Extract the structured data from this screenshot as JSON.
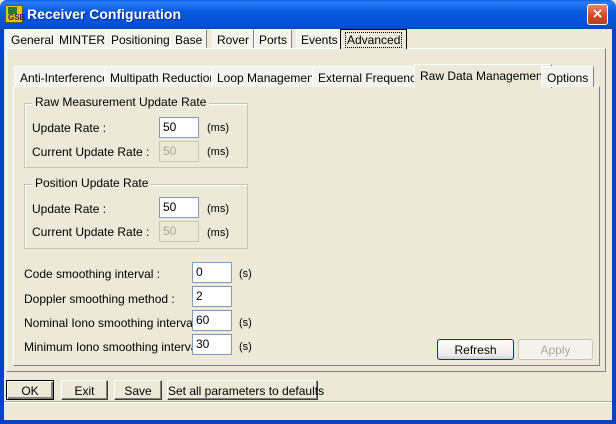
{
  "window": {
    "title": "Receiver Configuration",
    "close_glyph": "×",
    "icon_text": "GSB"
  },
  "outer_tabs": [
    "General",
    "MINTER",
    "Positioning",
    "Base",
    "Rover",
    "Ports",
    "Events",
    "Advanced"
  ],
  "inner_tabs": [
    "Anti-Interference",
    "Multipath Reduction",
    "Loop Management",
    "External Frequency",
    "Raw Data Management",
    "Options"
  ],
  "raw_group": {
    "title": "Raw Measurement Update Rate",
    "update_label": "Update Rate :",
    "update_value": "50",
    "update_unit": "(ms)",
    "current_label": "Current Update Rate :",
    "current_value": "50",
    "current_unit": "(ms)"
  },
  "pos_group": {
    "title": "Position Update Rate",
    "update_label": "Update Rate :",
    "update_value": "50",
    "update_unit": "(ms)",
    "current_label": "Current Update Rate :",
    "current_value": "50",
    "current_unit": "(ms)"
  },
  "smoothing": {
    "code_label": "Code smoothing interval :",
    "code_value": "0",
    "code_unit": "(s)",
    "doppler_label": "Doppler smoothing method :",
    "doppler_value": "2",
    "nominal_label": "Nominal Iono smoothing interval :",
    "nominal_value": "60",
    "nominal_unit": "(s)",
    "minimum_label": "Minimum Iono smoothing interval :",
    "minimum_value": "30",
    "minimum_unit": "(s)"
  },
  "panel_buttons": {
    "refresh": "Refresh",
    "apply": "Apply"
  },
  "bottom_buttons": {
    "ok": "OK",
    "exit": "Exit",
    "save": "Save",
    "defaults": "Set all parameters to defaults"
  },
  "colors": {
    "titlebar": "#0a5ae0",
    "face": "#ece9d8",
    "field_border": "#7f9db9"
  }
}
